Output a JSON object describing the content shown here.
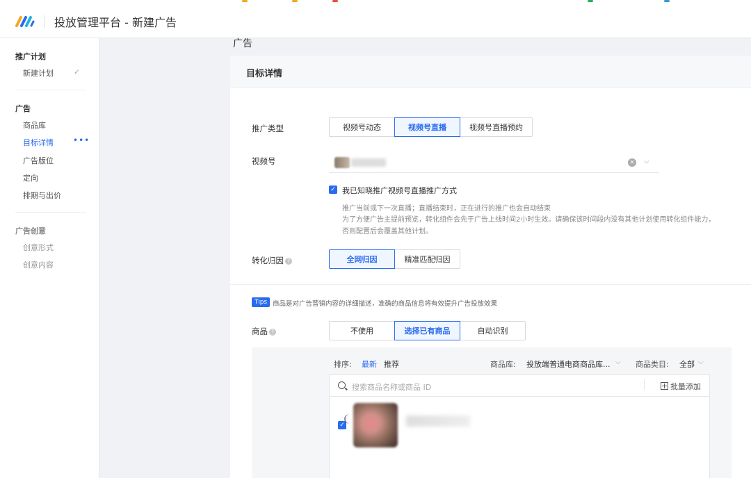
{
  "header": {
    "title": "投放管理平台 - 新建广告"
  },
  "sidebar": {
    "groups": [
      {
        "label": "推广计划",
        "items": [
          {
            "label": "新建计划"
          }
        ]
      },
      {
        "label": "广告",
        "items": [
          {
            "label": "商品库"
          },
          {
            "label": "目标详情"
          },
          {
            "label": "广告版位"
          },
          {
            "label": "定向"
          },
          {
            "label": "排期与出价"
          }
        ]
      },
      {
        "label": "广告创意",
        "items": [
          {
            "label": "创意形式"
          },
          {
            "label": "创意内容"
          }
        ]
      }
    ],
    "active_item": "目标详情"
  },
  "main": {
    "section_title": "广告",
    "card_title": "目标详情",
    "promo_type": {
      "label": "推广类型",
      "options": [
        "视频号动态",
        "视频号直播",
        "视频号直播预约"
      ],
      "selected": "视频号直播"
    },
    "channel": {
      "label": "视频号"
    },
    "agree": {
      "checked": true,
      "label": "我已知晓推广视频号直播推广方式",
      "notes": [
        "推广当前或下一次直播；直播结束时，正在进行的推广也会自动结束",
        "为了方便广告主提前预览，转化组件会先于广告上线时间2小时生效。请确保该时间段内没有其他计划使用转化组件能力，",
        "否则配置后会覆盖其他计划。"
      ]
    },
    "attribution": {
      "label": "转化归因",
      "options": [
        "全网归因",
        "精准匹配归因"
      ],
      "selected": "全网归因"
    },
    "tips": {
      "badge": "Tips",
      "text": "商品是对广告营销内容的详细描述，准确的商品信息将有效提升广告投放效果"
    },
    "product": {
      "label": "商品",
      "options": [
        "不使用",
        "选择已有商品",
        "自动识别"
      ],
      "selected": "选择已有商品",
      "sort_label": "排序:",
      "sort_options": [
        "最新",
        "推荐"
      ],
      "sort_active": "最新",
      "library_label": "商品库:",
      "library_value": "投放端普通电商商品库...",
      "category_label": "商品类目:",
      "category_value": "全部",
      "search_placeholder": "搜索商品名称或商品 ID",
      "batch_add_label": "批量添加",
      "item_checked": true
    }
  },
  "colors": {
    "accent": "#296bef",
    "page_bg": "#f0f2f5"
  }
}
